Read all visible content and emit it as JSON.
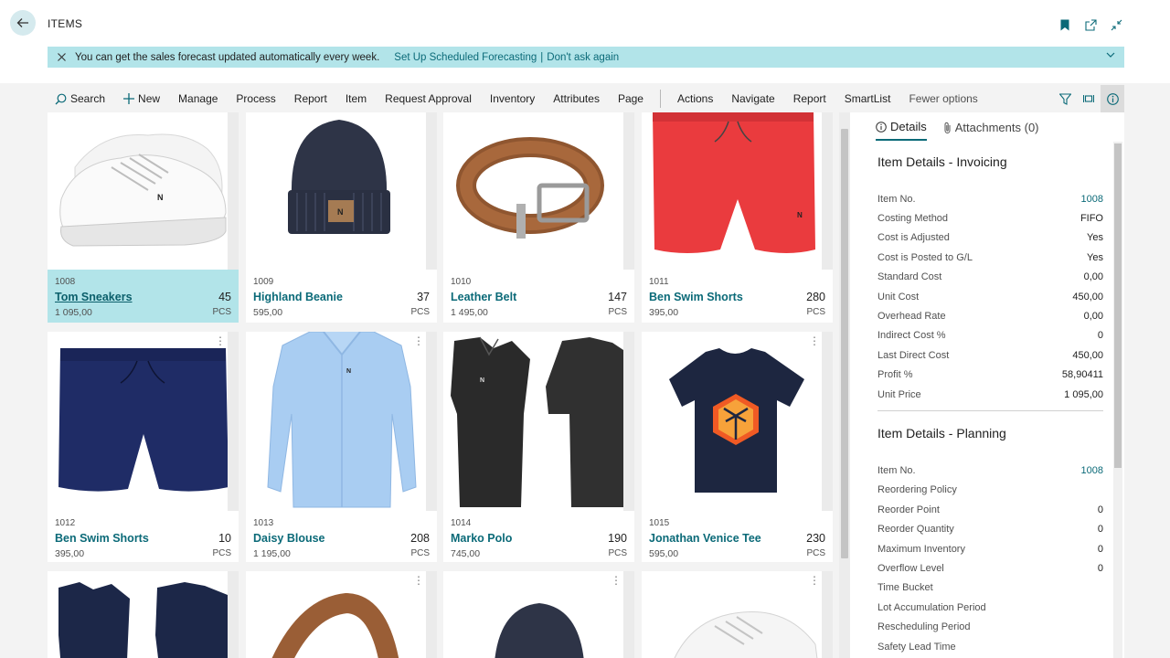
{
  "header": {
    "title": "ITEMS",
    "back_icon": "arrow-left-icon",
    "icons": [
      "bookmark-icon",
      "open-new-window-icon",
      "collapse-icon"
    ]
  },
  "banner": {
    "message": "You can get the sales forecast updated automatically every week.",
    "link1": "Set Up Scheduled Forecasting",
    "separator": "|",
    "link2": "Don't ask again"
  },
  "actions": {
    "search": "Search",
    "new": "New",
    "manage": "Manage",
    "process": "Process",
    "report": "Report",
    "item": "Item",
    "request_approval": "Request Approval",
    "inventory": "Inventory",
    "attributes": "Attributes",
    "page": "Page",
    "actions": "Actions",
    "navigate": "Navigate",
    "report2": "Report",
    "smartlist": "SmartList",
    "fewer": "Fewer options"
  },
  "tiles": [
    {
      "no": "1008",
      "name": "Tom Sneakers",
      "qty": "45",
      "price": "1 095,00",
      "unit": "PCS"
    },
    {
      "no": "1009",
      "name": "Highland Beanie",
      "qty": "37",
      "price": "595,00",
      "unit": "PCS"
    },
    {
      "no": "1010",
      "name": "Leather Belt",
      "qty": "147",
      "price": "1 495,00",
      "unit": "PCS"
    },
    {
      "no": "1011",
      "name": "Ben Swim Shorts",
      "qty": "280",
      "price": "395,00",
      "unit": "PCS"
    },
    {
      "no": "1012",
      "name": "Ben Swim Shorts",
      "qty": "10",
      "price": "395,00",
      "unit": "PCS"
    },
    {
      "no": "1013",
      "name": "Daisy Blouse",
      "qty": "208",
      "price": "1 195,00",
      "unit": "PCS"
    },
    {
      "no": "1014",
      "name": "Marko Polo",
      "qty": "190",
      "price": "745,00",
      "unit": "PCS"
    },
    {
      "no": "1015",
      "name": "Jonathan Venice Tee",
      "qty": "230",
      "price": "595,00",
      "unit": "PCS"
    }
  ],
  "factbox": {
    "tab_details": "Details",
    "tab_attachments": "Attachments (0)",
    "section1_title": "Item Details - Invoicing",
    "section1": [
      {
        "label": "Item No.",
        "value": "1008"
      },
      {
        "label": "Costing Method",
        "value": "FIFO"
      },
      {
        "label": "Cost is Adjusted",
        "value": "Yes"
      },
      {
        "label": "Cost is Posted to G/L",
        "value": "Yes"
      },
      {
        "label": "Standard Cost",
        "value": "0,00"
      },
      {
        "label": "Unit Cost",
        "value": "450,00"
      },
      {
        "label": "Overhead Rate",
        "value": "0,00"
      },
      {
        "label": "Indirect Cost %",
        "value": "0"
      },
      {
        "label": "Last Direct Cost",
        "value": "450,00"
      },
      {
        "label": "Profit %",
        "value": "58,90411"
      },
      {
        "label": "Unit Price",
        "value": "1 095,00"
      }
    ],
    "section2_title": "Item Details - Planning",
    "section2": [
      {
        "label": "Item No.",
        "value": "1008"
      },
      {
        "label": "Reordering Policy",
        "value": ""
      },
      {
        "label": "Reorder Point",
        "value": "0"
      },
      {
        "label": "Reorder Quantity",
        "value": "0"
      },
      {
        "label": "Maximum Inventory",
        "value": "0"
      },
      {
        "label": "Overflow Level",
        "value": "0"
      },
      {
        "label": "Time Bucket",
        "value": ""
      },
      {
        "label": "Lot Accumulation Period",
        "value": ""
      },
      {
        "label": "Rescheduling Period",
        "value": ""
      },
      {
        "label": "Safety Lead Time",
        "value": ""
      }
    ]
  },
  "colors": {
    "accent": "#0b6a78",
    "selected_tile": "#b2e4e9",
    "banner": "#b2e4e9"
  }
}
